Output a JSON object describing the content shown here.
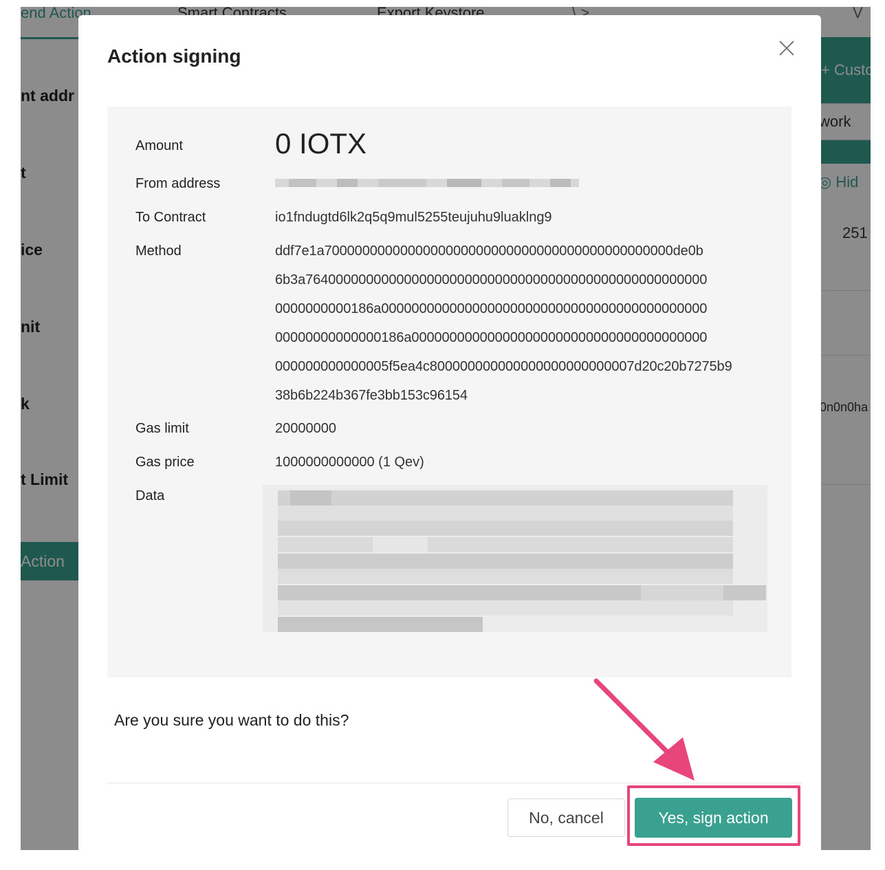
{
  "background": {
    "tabs": [
      "end Action",
      "Smart Contracts",
      "Export Keystore",
      "\\ >",
      "V"
    ],
    "labels": [
      "nt addr",
      "t",
      "ice",
      "nit",
      "k",
      "t Limit"
    ],
    "action_button": "Action",
    "custom_button": "+ Custo",
    "network_select": "work",
    "hide_label": "Hid",
    "number": "251",
    "hex_fragment": "0n0n0ha"
  },
  "modal": {
    "title": "Action signing",
    "close_icon": "close-icon",
    "details": {
      "amount_label": "Amount",
      "amount_value": "0 IOTX",
      "from_label": "From address",
      "to_label": "To Contract",
      "to_value": "io1fndugtd6lk2q5q9mul5255teujuhu9luaklng9",
      "method_label": "Method",
      "method_lines": [
        "ddf7e1a7000000000000000000000000000000000000000000000de0b",
        "6b3a76400000000000000000000000000000000000000000000000000",
        "0000000000186a0000000000000000000000000000000000000000000",
        "00000000000000186a000000000000000000000000000000000000000",
        "000000000000005f5ea4c800000000000000000000000007d20c20b7275b9",
        "38b6b224b367fe3bb153c96154"
      ],
      "gas_limit_label": "Gas limit",
      "gas_limit_value": "20000000",
      "gas_price_label": "Gas price",
      "gas_price_value": "1000000000000 (1 Qev)",
      "data_label": "Data"
    },
    "question": "Are you sure you want to do this?",
    "cancel_label": "No, cancel",
    "confirm_label": "Yes, sign action"
  },
  "colors": {
    "accent": "#3aa191",
    "highlight": "#e8457b"
  }
}
